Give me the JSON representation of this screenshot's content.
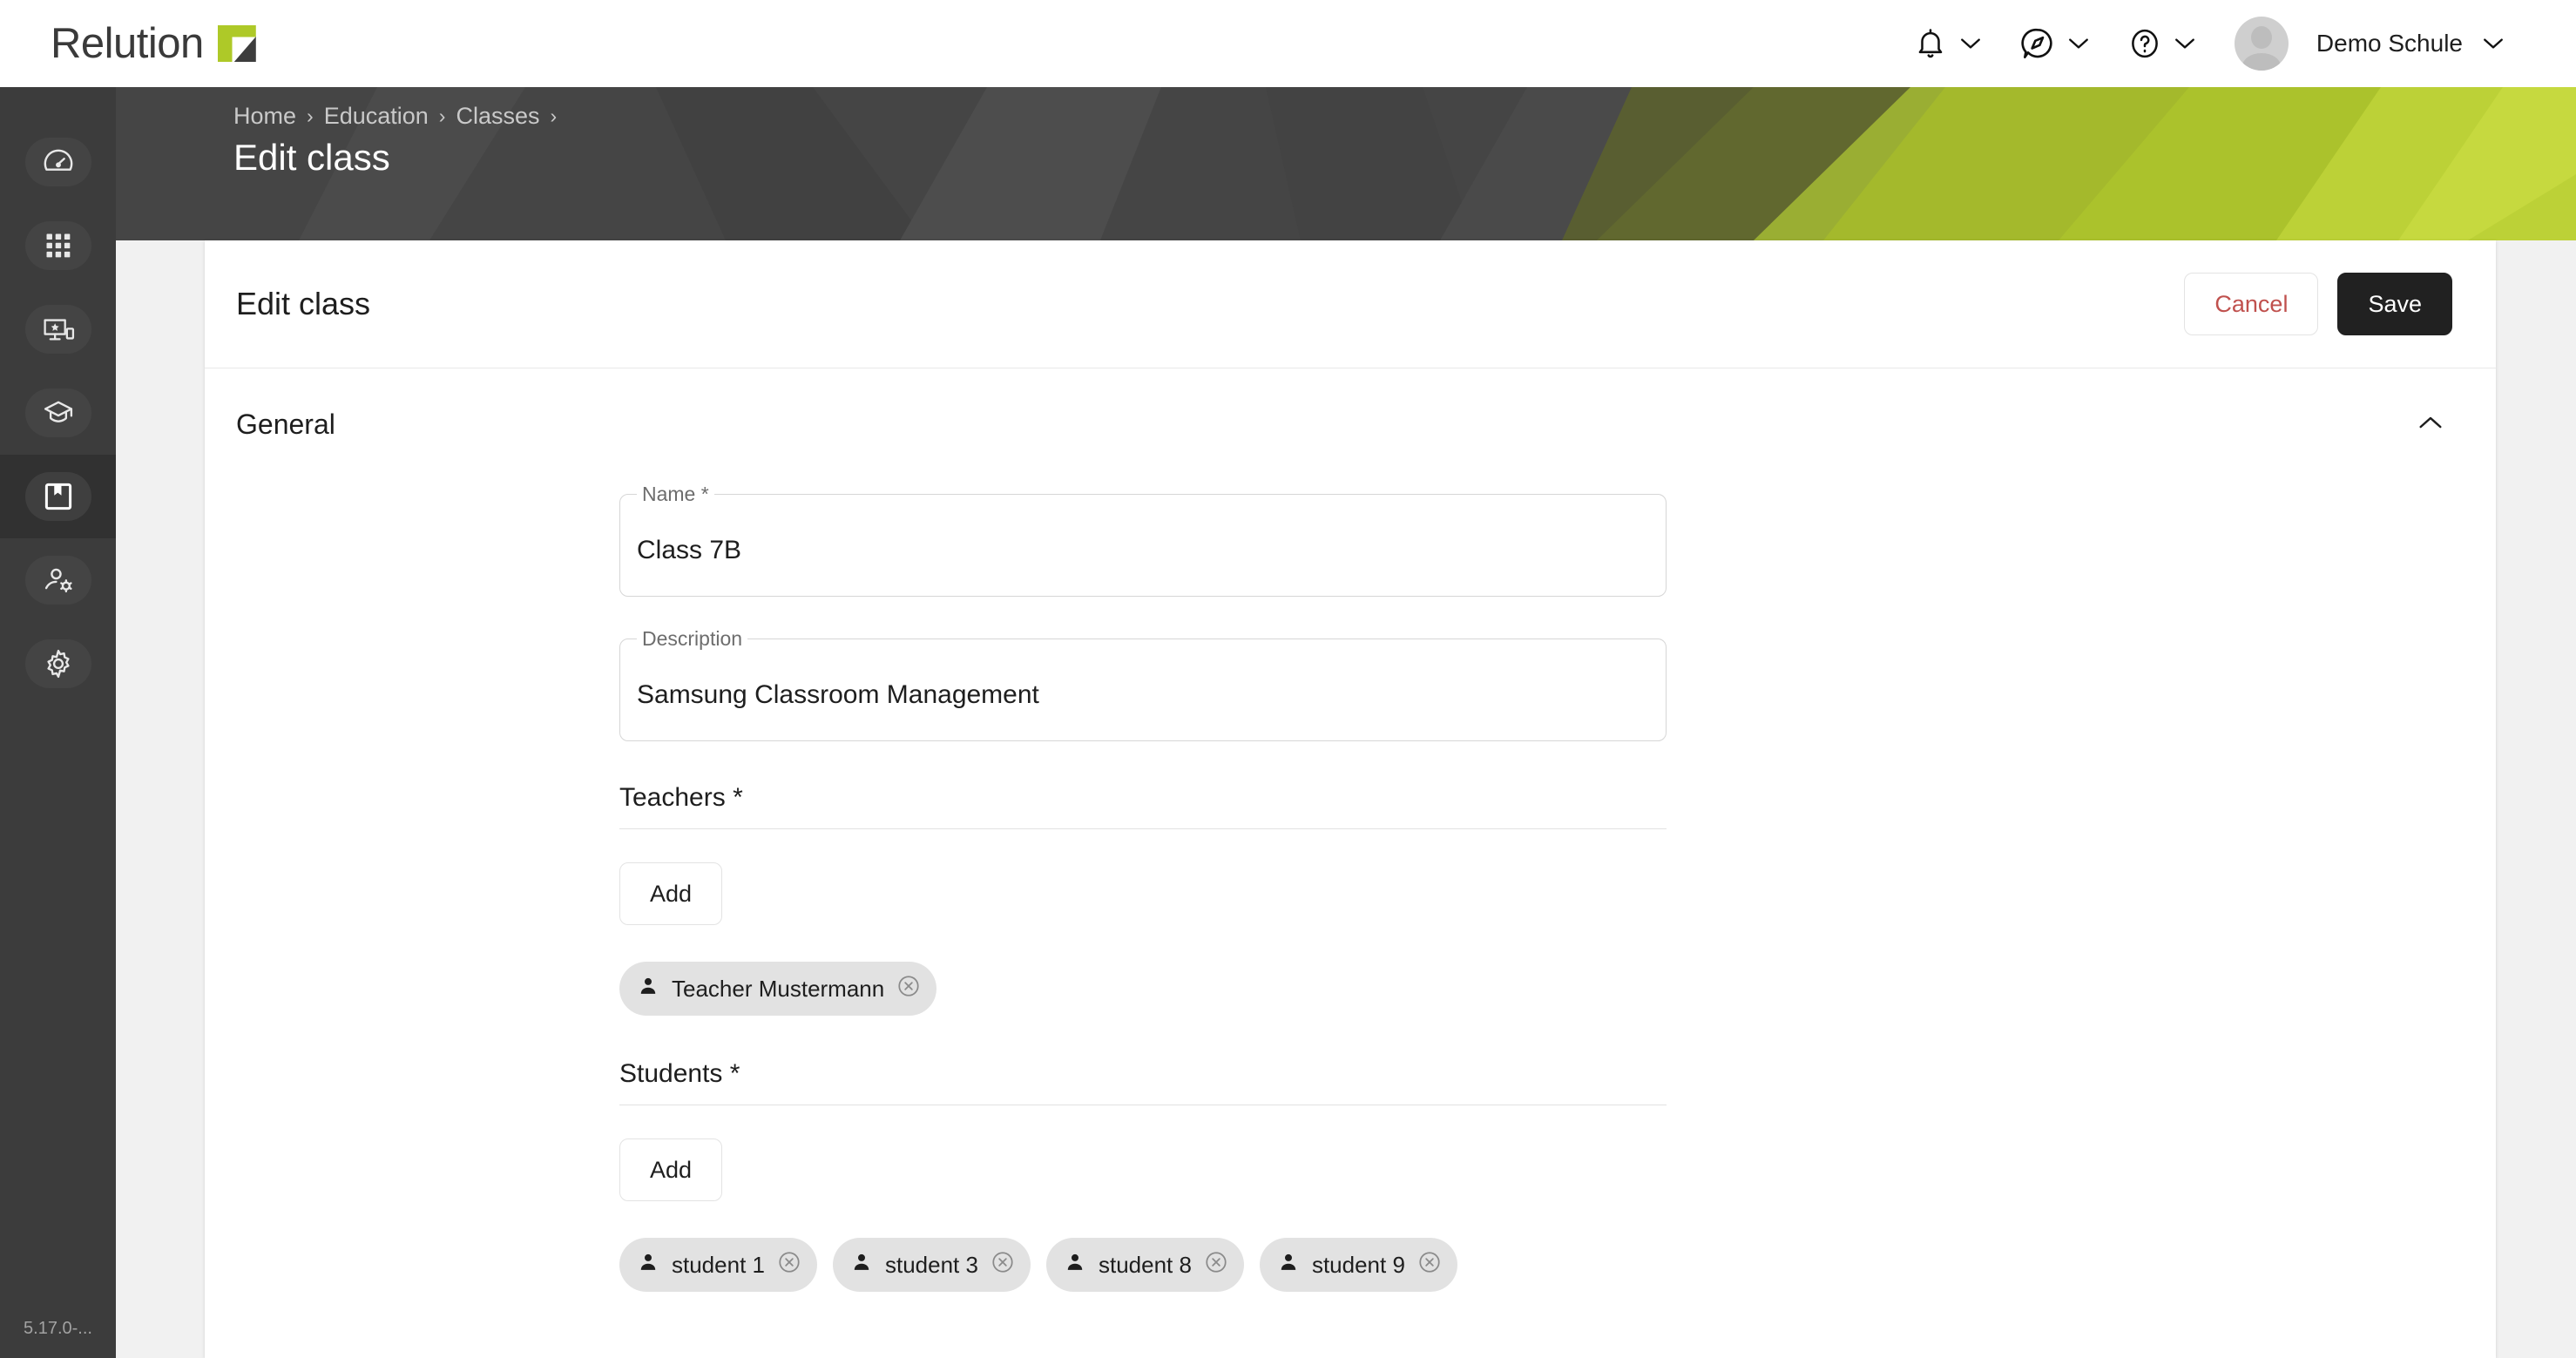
{
  "app": {
    "brand_name": "Relution",
    "brand_green": "#aec928",
    "brand_dark": "#3d3d3d",
    "version": "5.17.0-..."
  },
  "topbar": {
    "items": [
      {
        "name": "notifications",
        "icon": "bell-icon",
        "chevron": "chevron-down-icon"
      },
      {
        "name": "feedback",
        "icon": "compass-chat-icon",
        "chevron": "chevron-down-icon"
      },
      {
        "name": "help",
        "icon": "question-circle-icon",
        "chevron": "chevron-down-icon"
      }
    ],
    "user": {
      "name": "Demo Schule",
      "avatar": "avatar-placeholder-icon",
      "chevron": "chevron-down-icon"
    }
  },
  "sidebar": {
    "items": [
      {
        "label": "Dashboard",
        "icon": "gauge-icon",
        "active": false
      },
      {
        "label": "Apps",
        "icon": "grid-apps-icon",
        "active": false
      },
      {
        "label": "Devices",
        "icon": "device-star-icon",
        "active": false
      },
      {
        "label": "Education",
        "icon": "graduation-cap-icon",
        "active": false
      },
      {
        "label": "Classes",
        "icon": "book-bookmark-icon",
        "active": true
      },
      {
        "label": "Users",
        "icon": "user-gear-icon",
        "active": false
      },
      {
        "label": "Settings",
        "icon": "gear-icon",
        "active": false
      }
    ]
  },
  "banner": {
    "breadcrumb": [
      {
        "label": "Home"
      },
      {
        "label": "Education"
      },
      {
        "label": "Classes"
      }
    ],
    "breadcrumb_separator": "›",
    "trailing_separator": "›",
    "title": "Edit class",
    "bg_dark": "#454545",
    "bg_green": "#aec92c"
  },
  "card": {
    "title": "Edit class",
    "cancel_label": "Cancel",
    "save_label": "Save",
    "cancel_color": "#c0514e",
    "save_bg": "#212121"
  },
  "section": {
    "title": "General",
    "toggle_icon": "chevron-up-icon"
  },
  "form": {
    "fields": [
      {
        "label": "Name *",
        "value": "Class 7B",
        "placeholder": "Name"
      },
      {
        "label": "Description",
        "value": "Samsung Classroom Management",
        "placeholder": "Description"
      }
    ],
    "groups": [
      {
        "key": "teachers",
        "label": "Teachers *",
        "add_label": "Add",
        "chips": [
          {
            "label": "Teacher Mustermann",
            "icon": "person-icon",
            "remove_icon": "remove-circle-icon"
          }
        ]
      },
      {
        "key": "students",
        "label": "Students *",
        "add_label": "Add",
        "chips": [
          {
            "label": "student 1",
            "icon": "person-icon",
            "remove_icon": "remove-circle-icon"
          },
          {
            "label": "student 3",
            "icon": "person-icon",
            "remove_icon": "remove-circle-icon"
          },
          {
            "label": "student 8",
            "icon": "person-icon",
            "remove_icon": "remove-circle-icon"
          },
          {
            "label": "student 9",
            "icon": "person-icon",
            "remove_icon": "remove-circle-icon"
          }
        ]
      }
    ]
  }
}
